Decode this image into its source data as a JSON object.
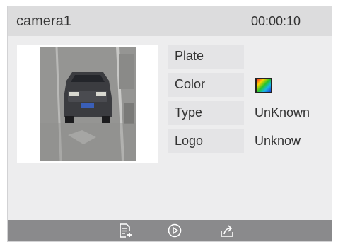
{
  "header": {
    "camera_name": "camera1",
    "time": "00:00:10"
  },
  "details": [
    {
      "label": "Plate",
      "value": ""
    },
    {
      "label": "Color",
      "value": ""
    },
    {
      "label": "Type",
      "value": "UnKnown"
    },
    {
      "label": "Logo",
      "value": "Unknow"
    }
  ],
  "color_swatch": {
    "type": "color-spectrum",
    "colors": [
      "#ff2a2a",
      "#ffd400",
      "#27c42a",
      "#18b6e8",
      "#1c3cd6"
    ]
  },
  "toolbar": {
    "icons": [
      "export-record-icon",
      "play-icon",
      "share-icon"
    ]
  }
}
